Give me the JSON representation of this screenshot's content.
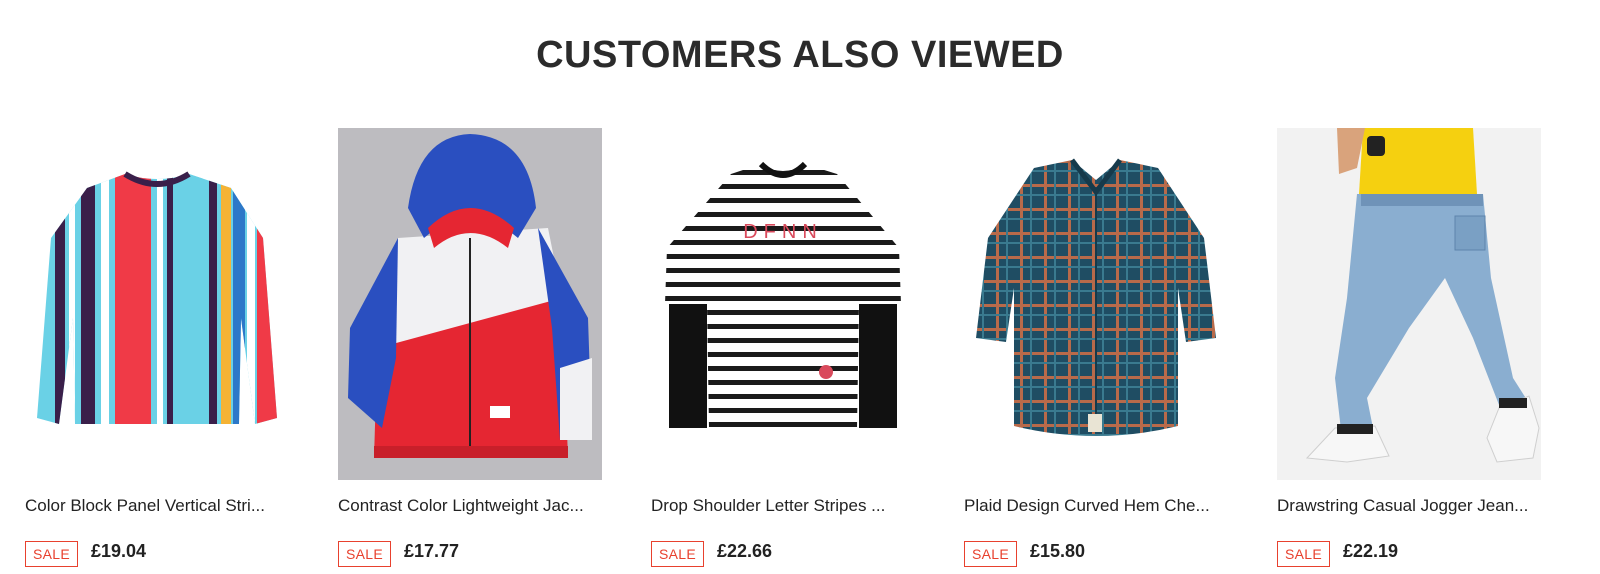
{
  "section": {
    "title": "CUSTOMERS ALSO VIEWED"
  },
  "products": [
    {
      "name": "Color Block Panel Vertical Stri...",
      "badge": "SALE",
      "price": "£19.04",
      "image_icon": "striped-sweatshirt-image"
    },
    {
      "name": "Contrast Color Lightweight Jac...",
      "badge": "SALE",
      "price": "£17.77",
      "image_icon": "hooded-jacket-image"
    },
    {
      "name": "Drop Shoulder Letter Stripes ...",
      "badge": "SALE",
      "price": "£22.66",
      "image_icon": "striped-tee-image"
    },
    {
      "name": "Plaid Design Curved Hem Che...",
      "badge": "SALE",
      "price": "£15.80",
      "image_icon": "plaid-shirt-image"
    },
    {
      "name": "Drawstring Casual Jogger Jean...",
      "badge": "SALE",
      "price": "£22.19",
      "image_icon": "jogger-jeans-image"
    }
  ],
  "colors": {
    "sale_red": "#e8412e",
    "title_text": "#2b2b2b"
  }
}
